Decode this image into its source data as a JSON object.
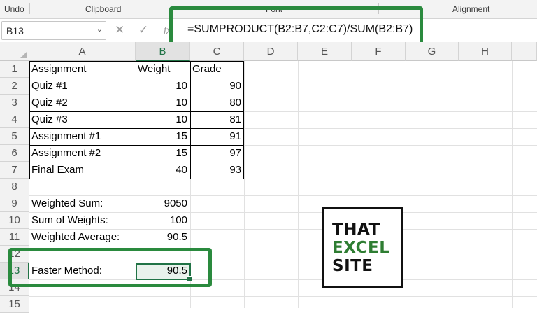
{
  "ribbon": {
    "groups": [
      "Undo",
      "Clipboard",
      "Font",
      "Alignment"
    ]
  },
  "formula_bar": {
    "name_box": "B13",
    "name_box_chevron": "⌄",
    "cancel_icon": "✕",
    "enter_icon": "✓",
    "fx_icon": "fx",
    "formula": "=SUMPRODUCT(B2:B7,C2:C7)/SUM(B2:B7)"
  },
  "columns": [
    "A",
    "B",
    "C",
    "D",
    "E",
    "F",
    "G",
    "H"
  ],
  "rows": [
    "1",
    "2",
    "3",
    "4",
    "5",
    "6",
    "7",
    "8",
    "9",
    "10",
    "11",
    "12",
    "13",
    "14",
    "15"
  ],
  "table": {
    "headers": [
      "Assignment",
      "Weight",
      "Grade"
    ],
    "rows": [
      {
        "assignment": "Quiz #1",
        "weight": "10",
        "grade": "90"
      },
      {
        "assignment": "Quiz #2",
        "weight": "10",
        "grade": "80"
      },
      {
        "assignment": "Quiz #3",
        "weight": "10",
        "grade": "81"
      },
      {
        "assignment": "Assignment #1",
        "weight": "15",
        "grade": "91"
      },
      {
        "assignment": "Assignment #2",
        "weight": "15",
        "grade": "97"
      },
      {
        "assignment": "Final Exam",
        "weight": "40",
        "grade": "93"
      }
    ]
  },
  "summary": {
    "weighted_sum_label": "Weighted Sum:",
    "weighted_sum_value": "9050",
    "sum_weights_label": "Sum of Weights:",
    "sum_weights_value": "100",
    "weighted_avg_label": "Weighted Average:",
    "weighted_avg_value": "90.5",
    "faster_label": "Faster Method:",
    "faster_value": "90.5"
  },
  "logo": {
    "line1": "THAT",
    "line2": "EXCEL",
    "line3": "SITE"
  },
  "colors": {
    "highlight_green": "#2a8a3e",
    "excel_green": "#217346",
    "logo_excel_green": "#2e7d32"
  }
}
